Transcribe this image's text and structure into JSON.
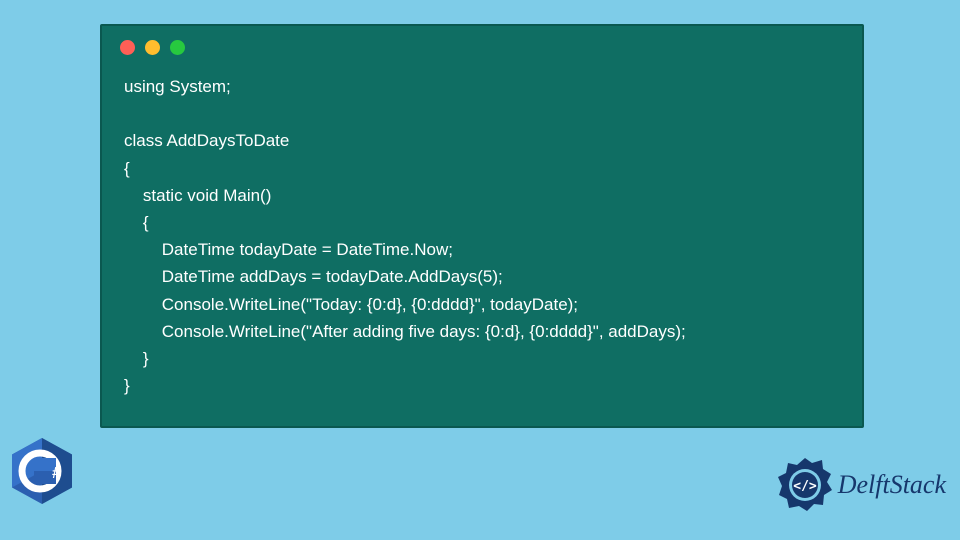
{
  "code": {
    "line1": "using System;",
    "line2": "",
    "line3": "class AddDaysToDate",
    "line4": "{",
    "line5": "    static void Main()",
    "line6": "    {",
    "line7": "        DateTime todayDate = DateTime.Now;",
    "line8": "        DateTime addDays = todayDate.AddDays(5);",
    "line9": "        Console.WriteLine(\"Today: {0:d}, {0:dddd}\", todayDate);",
    "line10": "        Console.WriteLine(\"After adding five days: {0:d}, {0:dddd}\", addDays);",
    "line11": "    }",
    "line12": "}"
  },
  "logos": {
    "csharp_label": "C#",
    "delftstack_text": "DelftStack",
    "delftstack_badge_text": "</>"
  },
  "colors": {
    "background": "#7ecce8",
    "window_bg": "#0f6e63",
    "csharp_purple": "#68217a",
    "delft_blue": "#16376c"
  }
}
